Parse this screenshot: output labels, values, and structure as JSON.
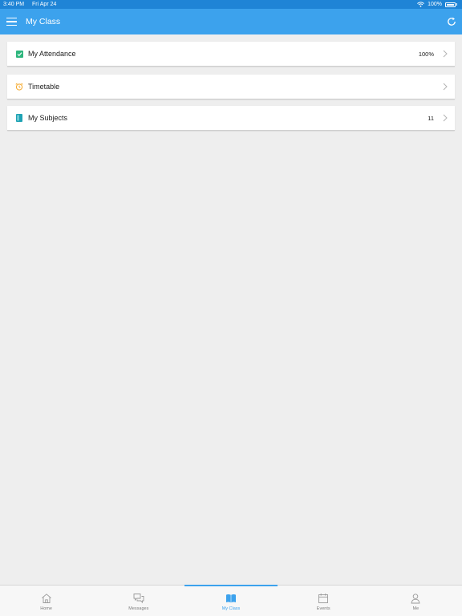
{
  "status_bar": {
    "time": "3:40 PM",
    "date": "Fri Apr 24",
    "battery": "100%"
  },
  "header": {
    "title": "My Class"
  },
  "items": [
    {
      "label": "My Attendance",
      "value": "100%",
      "icon": "check-square-icon"
    },
    {
      "label": "Timetable",
      "value": "",
      "icon": "alarm-clock-icon"
    },
    {
      "label": "My Subjects",
      "value": "11",
      "icon": "book-icon"
    }
  ],
  "tabs": [
    {
      "label": "Home",
      "icon": "home-icon"
    },
    {
      "label": "Messages",
      "icon": "messages-icon"
    },
    {
      "label": "My Class",
      "icon": "open-book-icon",
      "active": true
    },
    {
      "label": "Events",
      "icon": "calendar-icon"
    },
    {
      "label": "Me",
      "icon": "user-icon"
    }
  ],
  "colors": {
    "status_bar": "#1f84d6",
    "header": "#3ca2ed",
    "accent": "#3ca2ed",
    "attendance_icon": "#2eb67d",
    "timetable_icon": "#f5a623",
    "subjects_icon": "#1fa3b4"
  }
}
